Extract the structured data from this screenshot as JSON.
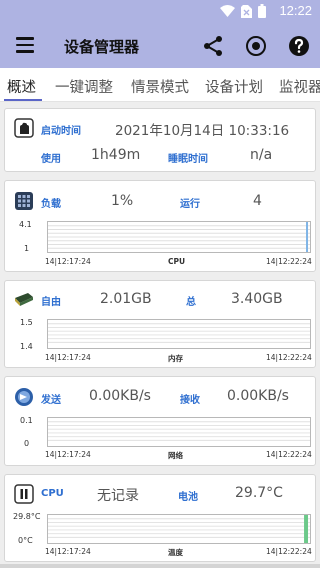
{
  "status_bar": {
    "time": "12:22",
    "icons": [
      "wifi-icon",
      "sim-off-icon",
      "battery-icon"
    ]
  },
  "app_bar": {
    "title": "设备管理器",
    "actions": [
      "share-icon",
      "record-icon",
      "help-icon"
    ]
  },
  "tabs": [
    {
      "label": "概述",
      "active": true
    },
    {
      "label": "一键调整"
    },
    {
      "label": "情景模式"
    },
    {
      "label": "设备计划"
    },
    {
      "label": "监视器"
    }
  ],
  "colors": {
    "accent": "#5b66c7",
    "label_blue": "#2f6fd0",
    "appbar": "#aeb3e2"
  },
  "cards": {
    "uptime": {
      "icon": "device-icon",
      "boot_label": "启动时间",
      "boot_value": "2021年10月14日 10:33:16",
      "usage_label": "使用",
      "usage_value": "1h49m",
      "sleep_label": "睡眠时间",
      "sleep_value": "n/a"
    },
    "cpu": {
      "icon": "cpu-chip-icon",
      "left_label": "负载",
      "left_value": "1%",
      "right_label": "运行",
      "right_value": "4",
      "y_top": "4.1",
      "y_bottom": "1",
      "x_start": "14|12:17:24",
      "x_center": "CPU",
      "x_end": "14|12:22:24"
    },
    "memory": {
      "icon": "memory-module-icon",
      "left_label": "自由",
      "left_value": "2.01GB",
      "right_label": "总",
      "right_value": "3.40GB",
      "y_top": "1.5",
      "y_bottom": "1.4",
      "x_start": "14|12:17:24",
      "x_center": "内存",
      "x_end": "14|12:22:24"
    },
    "network": {
      "icon": "network-globe-icon",
      "left_label": "发送",
      "left_value": "0.00KB/s",
      "right_label": "接收",
      "right_value": "0.00KB/s",
      "y_top": "0.1",
      "y_bottom": "0",
      "x_start": "14|12:17:24",
      "x_center": "网络",
      "x_end": "14|12:22:24"
    },
    "temperature": {
      "icon": "battery-temp-icon",
      "left_label": "CPU",
      "left_value": "无记录",
      "right_label": "电池",
      "right_value": "29.7°C",
      "y_top": "29.8°C",
      "y_bottom": "0°C",
      "x_start": "14|12:17:24",
      "x_center": "温度",
      "x_end": "14|12:22:24"
    }
  }
}
